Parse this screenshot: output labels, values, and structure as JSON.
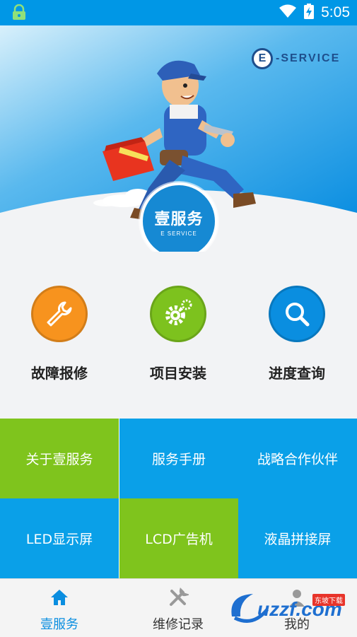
{
  "status_bar": {
    "time": "5:05"
  },
  "hero": {
    "brand_text": "-SERVICE",
    "brand_letter": "E",
    "logo_main": "壹服务",
    "logo_sub": "E SERVICE"
  },
  "features": [
    {
      "label": "故障报修",
      "icon": "wrench-icon",
      "color": "#f7931e"
    },
    {
      "label": "项目安装",
      "icon": "gear-icon",
      "color": "#7dc21e"
    },
    {
      "label": "进度查询",
      "icon": "search-icon",
      "color": "#0a8ee0"
    }
  ],
  "grid": [
    {
      "label": "关于壹服务",
      "color": "#7fc41d"
    },
    {
      "label": "服务手册",
      "color": "#0aa0e8"
    },
    {
      "label": "战略合作伙伴",
      "color": "#0aa0e8"
    },
    {
      "label": "LED显示屏",
      "color": "#0aa0e8"
    },
    {
      "label": "LCD广告机",
      "color": "#7fc41d"
    },
    {
      "label": "液晶拼接屏",
      "color": "#0aa0e8"
    }
  ],
  "tabs": [
    {
      "label": "壹服务",
      "icon": "home-icon",
      "active": true
    },
    {
      "label": "维修记录",
      "icon": "tools-icon",
      "active": false
    },
    {
      "label": "我的",
      "icon": "user-icon",
      "active": false
    }
  ],
  "watermark": {
    "text": "uzzf.com",
    "sub": "东坡下载"
  }
}
